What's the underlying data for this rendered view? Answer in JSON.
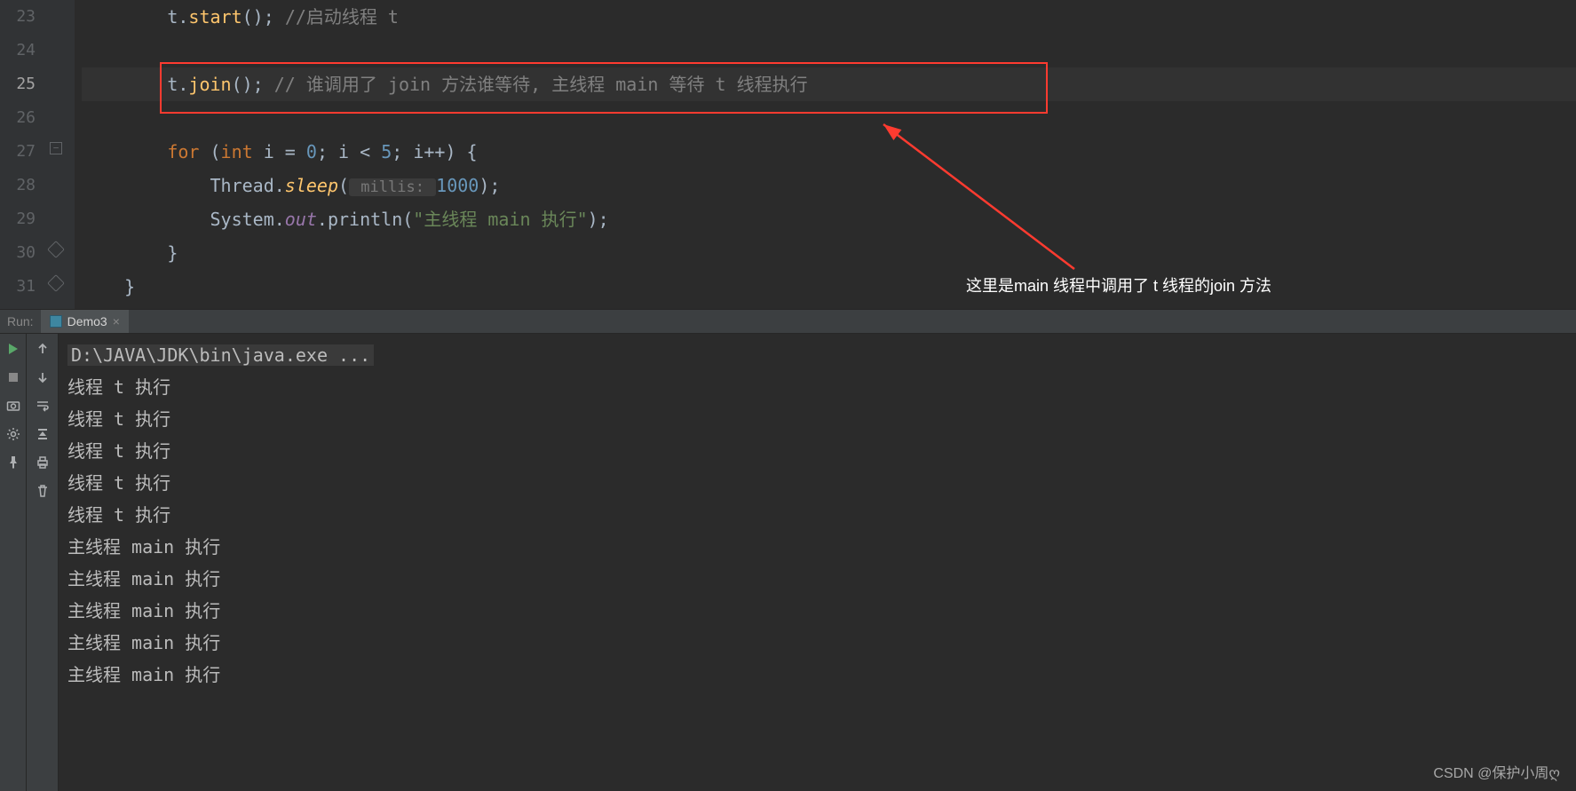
{
  "editor": {
    "line_numbers": [
      "23",
      "24",
      "25",
      "26",
      "27",
      "28",
      "29",
      "30",
      "31"
    ],
    "highlight_line": 2,
    "code": {
      "l23_a": "        t.",
      "l23_fn": "start",
      "l23_b": "(); ",
      "l23_c": "//启动线程 t",
      "l25_a": "        t.",
      "l25_fn": "join",
      "l25_b": "(); ",
      "l25_c": "// 谁调用了 join 方法谁等待, 主线程 main 等待 t 线程执行",
      "l27_a": "        ",
      "l27_kw1": "for",
      "l27_b": " (",
      "l27_kw2": "int",
      "l27_c": " i = ",
      "l27_n1": "0",
      "l27_d": "; i < ",
      "l27_n2": "5",
      "l27_e": "; i++) {",
      "l28_a": "            Thread.",
      "l28_fn": "sleep",
      "l28_b": "(",
      "l28_hint": " millis: ",
      "l28_n": "1000",
      "l28_c": ");",
      "l29_a": "            System.",
      "l29_fld": "out",
      "l29_b": ".println(",
      "l29_str": "\"主线程 main 执行\"",
      "l29_c": ");",
      "l30": "        }",
      "l31": "    }"
    },
    "annotation_text": "这里是main 线程中调用了 t 线程的join 方法"
  },
  "run": {
    "label": "Run:",
    "tab_name": "Demo3",
    "command": "D:\\JAVA\\JDK\\bin\\java.exe ...",
    "output": [
      "线程 t 执行",
      "线程 t 执行",
      "线程 t 执行",
      "线程 t 执行",
      "线程 t 执行",
      "主线程 main 执行",
      "主线程 main 执行",
      "主线程 main 执行",
      "主线程 main 执行",
      "主线程 main 执行"
    ]
  },
  "watermark": "CSDN @保护小周ღ"
}
